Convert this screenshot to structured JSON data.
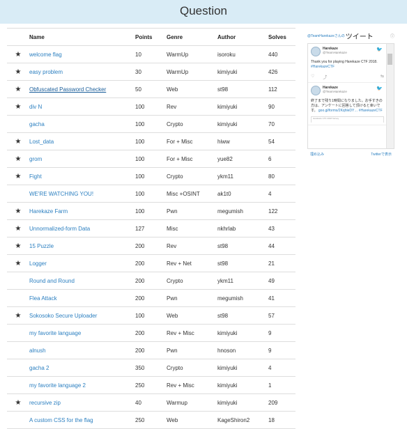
{
  "page": {
    "title": "Question"
  },
  "table": {
    "headers": {
      "name": "Name",
      "points": "Points",
      "genre": "Genre",
      "author": "Author",
      "solves": "Solves"
    },
    "rows": [
      {
        "star": "★",
        "name": "welcome flag",
        "points": "10",
        "genre": "WarmUp",
        "author": "isoroku",
        "solves": "440"
      },
      {
        "star": "★",
        "name": "easy problem",
        "points": "30",
        "genre": "WarmUp",
        "author": "kimiyuki",
        "solves": "426"
      },
      {
        "star": "★",
        "name": "Obfuscated Password Checker",
        "points": "50",
        "genre": "Web",
        "author": "st98",
        "solves": "112"
      },
      {
        "star": "★",
        "name": "div N",
        "points": "100",
        "genre": "Rev",
        "author": "kimiyuki",
        "solves": "90"
      },
      {
        "star": "",
        "name": "gacha",
        "points": "100",
        "genre": "Crypto",
        "author": "kimiyuki",
        "solves": "70"
      },
      {
        "star": "★",
        "name": "Lost_data",
        "points": "100",
        "genre": "For + Misc",
        "author": "hiww",
        "solves": "54"
      },
      {
        "star": "★",
        "name": "grom",
        "points": "100",
        "genre": "For + Misc",
        "author": "yue82",
        "solves": "6"
      },
      {
        "star": "★",
        "name": "Fight",
        "points": "100",
        "genre": "Crypto",
        "author": "ykm11",
        "solves": "80"
      },
      {
        "star": "",
        "name": "WE'RE WATCHING YOU!",
        "points": "100",
        "genre": "Misc +OSINT",
        "author": "ak1t0",
        "solves": "4"
      },
      {
        "star": "★",
        "name": "Harekaze Farm",
        "points": "100",
        "genre": "Pwn",
        "author": "megumish",
        "solves": "122"
      },
      {
        "star": "★",
        "name": "Unnormalized-form Data",
        "points": "127",
        "genre": "Misc",
        "author": "nkhrlab",
        "solves": "43"
      },
      {
        "star": "★",
        "name": "15 Puzzle",
        "points": "200",
        "genre": "Rev",
        "author": "st98",
        "solves": "44"
      },
      {
        "star": "★",
        "name": "Logger",
        "points": "200",
        "genre": "Rev + Net",
        "author": "st98",
        "solves": "21"
      },
      {
        "star": "",
        "name": "Round and Round",
        "points": "200",
        "genre": "Crypto",
        "author": "ykm11",
        "solves": "49"
      },
      {
        "star": "",
        "name": "Flea Attack",
        "points": "200",
        "genre": "Pwn",
        "author": "megumish",
        "solves": "41"
      },
      {
        "star": "★",
        "name": "Sokosoko Secure Uploader",
        "points": "100",
        "genre": "Web",
        "author": "st98",
        "solves": "57"
      },
      {
        "star": "",
        "name": "my favorite language",
        "points": "200",
        "genre": "Rev + Misc",
        "author": "kimiyuki",
        "solves": "9"
      },
      {
        "star": "",
        "name": "alnush",
        "points": "200",
        "genre": "Pwn",
        "author": "hnoson",
        "solves": "9"
      },
      {
        "star": "",
        "name": "gacha 2",
        "points": "350",
        "genre": "Crypto",
        "author": "kimiyuki",
        "solves": "4"
      },
      {
        "star": "",
        "name": "my favorite language 2",
        "points": "250",
        "genre": "Rev + Misc",
        "author": "kimiyuki",
        "solves": "1"
      },
      {
        "star": "★",
        "name": "recursive zip",
        "points": "40",
        "genre": "Warmup",
        "author": "kimiyuki",
        "solves": "209"
      },
      {
        "star": "",
        "name": "A custom CSS for the flag",
        "points": "250",
        "genre": "Web",
        "author": "KageShiron2",
        "solves": "18"
      }
    ]
  },
  "widget": {
    "header_prefix": "@TeamHarekazeさんの",
    "header_title": "ツイート",
    "info_icon": "info-icon",
    "tweets": [
      {
        "name": "Harekaze",
        "handle": "@TeamHarekaze",
        "text": "Thank you for playing Harekaze CTF 2018.",
        "hashtag": "#HarekazeCTF"
      },
      {
        "name": "Harekaze",
        "handle": "@TeamHarekaze",
        "text": "終了まで残り1時間になりました。お手すきの方は、アンケートに回答して頂けると幸いです。",
        "link": "goo.gl/forms/2KqhleDY…",
        "hashtag": "#HarekazeCTF",
        "card": "Harekaze CTF 2018 Survey"
      }
    ],
    "footer_embed": "埋め込み",
    "footer_view": "Twitterで表示"
  }
}
